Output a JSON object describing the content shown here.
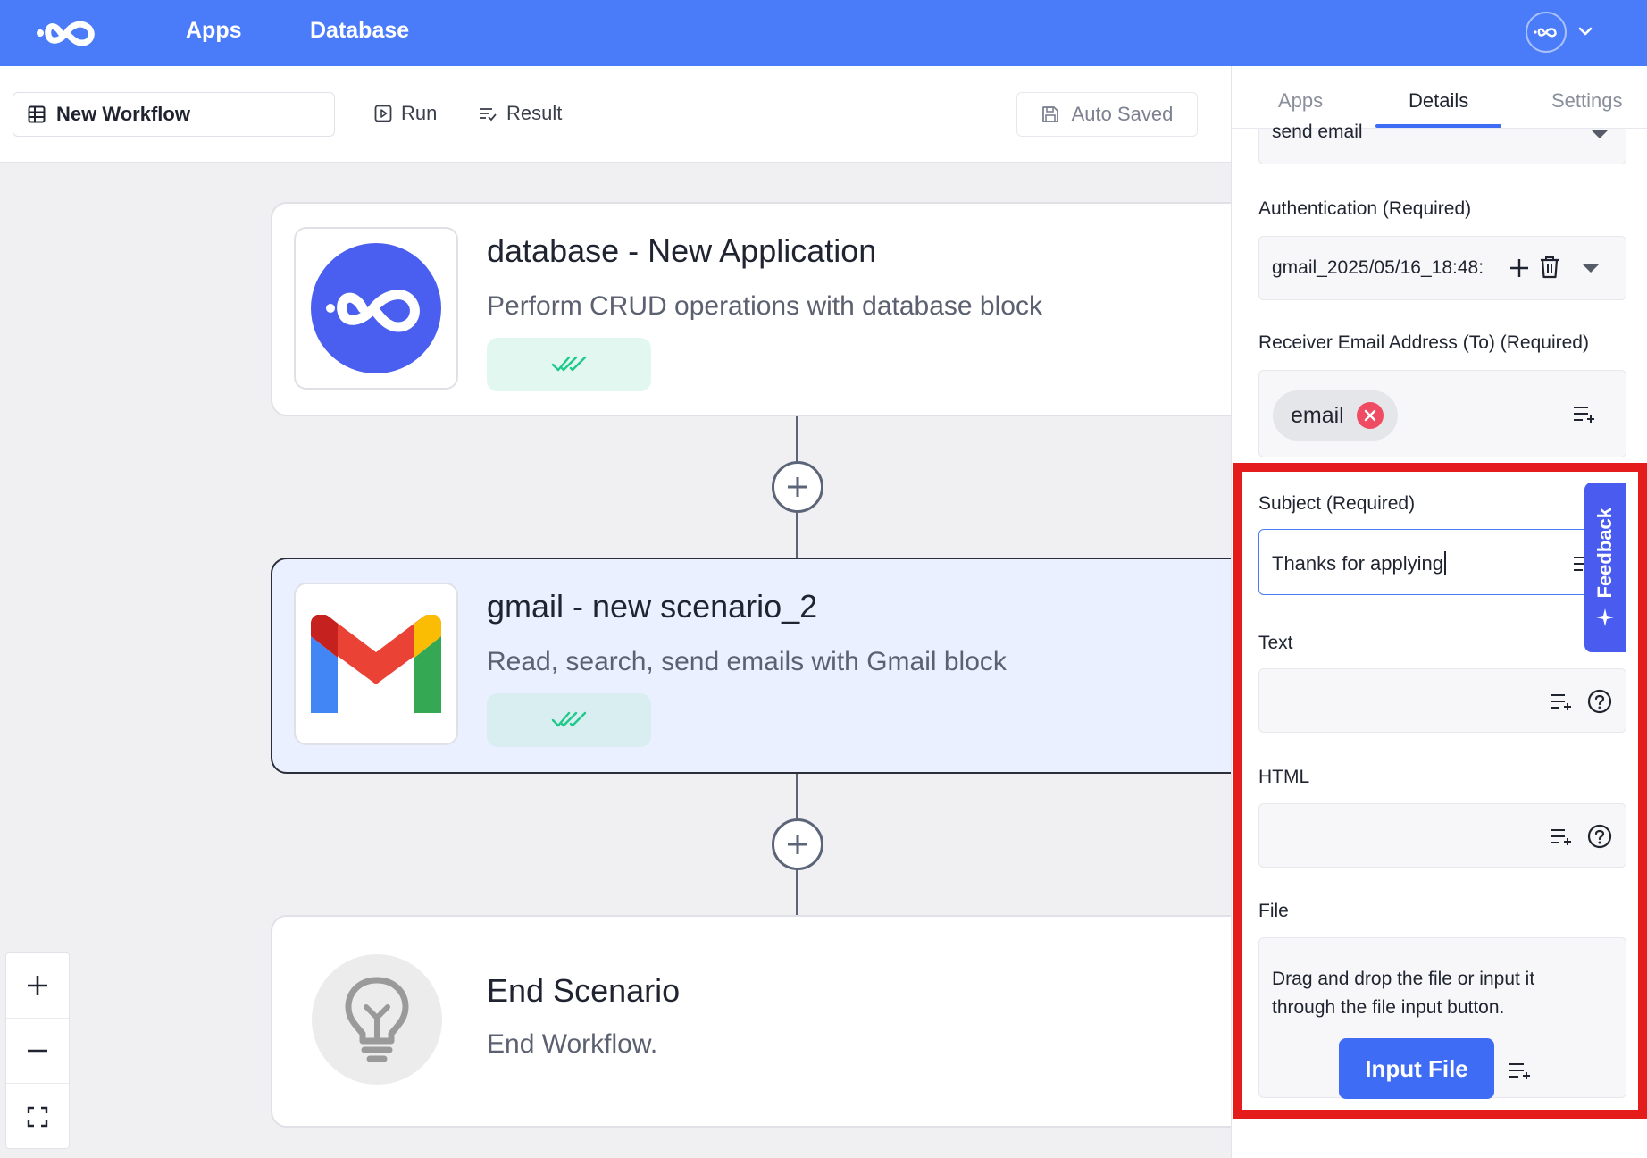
{
  "topbar": {
    "logo_icon": "infinity-logo-icon",
    "nav": [
      {
        "label": "Apps"
      },
      {
        "label": "Database"
      }
    ],
    "avatar_icon": "infinity-avatar-icon",
    "chevron_icon": "chevron-down-icon"
  },
  "toolbar": {
    "workflow_name": "New Workflow",
    "run_label": "Run",
    "result_label": "Result",
    "auto_saved_label": "Auto Saved"
  },
  "nodes": [
    {
      "title": "database - New Application",
      "description": "Perform CRUD operations with database block",
      "icon": "database-logo-icon",
      "status_icon": "double-check-icon"
    },
    {
      "title": "gmail - new scenario_2",
      "description": "Read, search, send emails with Gmail block",
      "icon": "gmail-logo-icon",
      "status_icon": "double-check-icon"
    },
    {
      "title": "End Scenario",
      "description": "End Workflow.",
      "icon": "lightbulb-icon"
    }
  ],
  "zoom": {
    "in_icon": "plus-icon",
    "out_icon": "minus-icon",
    "fit_icon": "fit-screen-icon"
  },
  "panel": {
    "tabs": [
      {
        "label": "Apps"
      },
      {
        "label": "Details"
      },
      {
        "label": "Settings"
      }
    ],
    "active_tab": "Details",
    "action_value": "send email",
    "auth": {
      "label": "Authentication (Required)",
      "value": "gmail_2025/05/16_18:48:"
    },
    "receiver": {
      "label": "Receiver Email Address (To) (Required)",
      "chip": "email"
    },
    "subject": {
      "label": "Subject (Required)",
      "value": "Thanks for applying"
    },
    "text": {
      "label": "Text"
    },
    "html": {
      "label": "HTML"
    },
    "file": {
      "label": "File",
      "help": "Drag and drop the file or input it through the file input button.",
      "button": "Input File"
    }
  },
  "feedback": {
    "label": "Feedback"
  },
  "colors": {
    "brand": "#4a7cf9",
    "accent": "#3f6cf4",
    "highlight": "#e41c1c",
    "success_bg": "#e1f7ef",
    "active_node_bg": "#eaf0ff"
  }
}
